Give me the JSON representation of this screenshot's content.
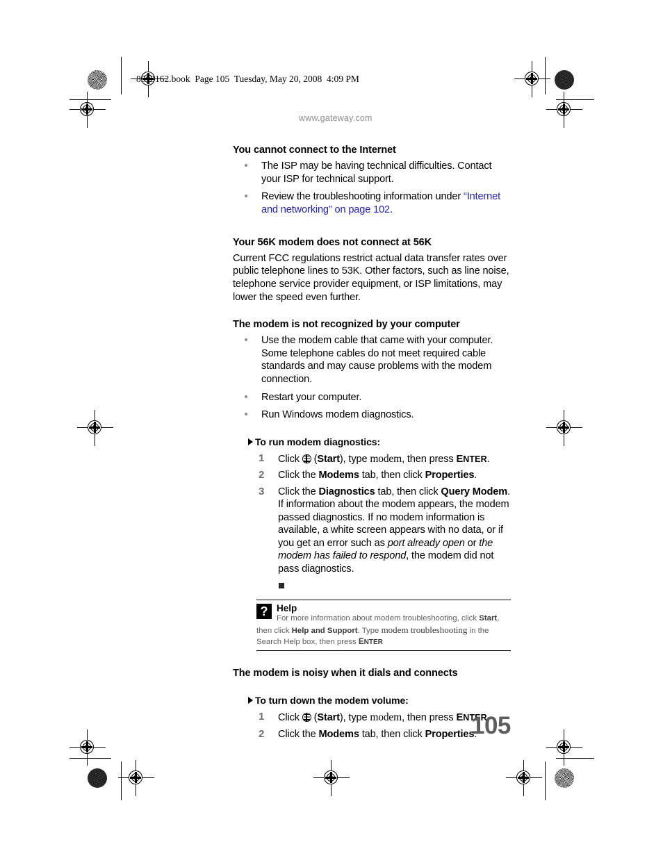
{
  "print_marks": {
    "book_info": "8513162.book  Page 105  Tuesday, May 20, 2008  4:09 PM"
  },
  "running_head": "www.gateway.com",
  "folio": "105",
  "sections": [
    {
      "id": "cannot-connect",
      "heading": "You cannot connect to the Internet",
      "bullets": [
        {
          "parts": [
            {
              "type": "text",
              "value": "The ISP may be having technical difficulties. Contact your ISP for technical support."
            }
          ]
        },
        {
          "parts": [
            {
              "type": "text",
              "value": "Review the troubleshooting information under "
            },
            {
              "type": "link",
              "value": "“Internet and networking” on page 102"
            },
            {
              "type": "text",
              "value": "."
            }
          ]
        }
      ]
    },
    {
      "id": "56k-modem",
      "heading": "Your 56K modem does not connect at 56K",
      "paragraph": "Current FCC regulations restrict actual data transfer rates over public telephone lines to 53K. Other factors, such as line noise, telephone service provider equipment, or ISP limitations, may lower the speed even further."
    },
    {
      "id": "not-recognized",
      "heading": "The modem is not recognized by your computer",
      "bullets": [
        {
          "parts": [
            {
              "type": "text",
              "value": "Use the modem cable that came with your computer. Some telephone cables do not meet required cable standards and may cause problems with the modem connection."
            }
          ]
        },
        {
          "parts": [
            {
              "type": "text",
              "value": "Restart your computer."
            }
          ]
        },
        {
          "parts": [
            {
              "type": "text",
              "value": "Run Windows modem diagnostics."
            }
          ]
        }
      ]
    },
    {
      "id": "noisy-modem",
      "heading": "The modem is noisy when it dials and connects"
    }
  ],
  "procedures": [
    {
      "id": "run-diagnostics",
      "title": "To run modem diagnostics:",
      "steps": [
        {
          "number": "1",
          "parts": [
            {
              "type": "text",
              "value": "Click "
            },
            {
              "type": "icon",
              "value": "start-orb-icon"
            },
            {
              "type": "text",
              "value": " ("
            },
            {
              "type": "bold",
              "value": "Start"
            },
            {
              "type": "text",
              "value": "), type "
            },
            {
              "type": "serif",
              "value": "modem"
            },
            {
              "type": "text",
              "value": ", then press "
            },
            {
              "type": "smallcaps",
              "value": "ENTER"
            },
            {
              "type": "text",
              "value": "."
            }
          ]
        },
        {
          "number": "2",
          "parts": [
            {
              "type": "text",
              "value": "Click the "
            },
            {
              "type": "bold",
              "value": "Modems"
            },
            {
              "type": "text",
              "value": " tab, then click "
            },
            {
              "type": "bold",
              "value": "Properties"
            },
            {
              "type": "text",
              "value": "."
            }
          ]
        },
        {
          "number": "3",
          "parts": [
            {
              "type": "text",
              "value": "Click the "
            },
            {
              "type": "bold",
              "value": "Diagnostics"
            },
            {
              "type": "text",
              "value": " tab, then click "
            },
            {
              "type": "bold",
              "value": "Query Modem"
            },
            {
              "type": "text",
              "value": ". If information about the modem appears, the modem passed diagnostics. If no modem information is available, a white screen appears with no data, or if you get an error such as "
            },
            {
              "type": "italic",
              "value": "port already open"
            },
            {
              "type": "text",
              "value": " or "
            },
            {
              "type": "italic",
              "value": "the modem has failed to respond"
            },
            {
              "type": "text",
              "value": ", the modem did not pass diagnostics."
            }
          ]
        }
      ],
      "end_marker": true
    },
    {
      "id": "turn-down-volume",
      "title": "To turn down the modem volume:",
      "steps": [
        {
          "number": "1",
          "parts": [
            {
              "type": "text",
              "value": "Click "
            },
            {
              "type": "icon",
              "value": "start-orb-icon"
            },
            {
              "type": "text",
              "value": " ("
            },
            {
              "type": "bold",
              "value": "Start"
            },
            {
              "type": "text",
              "value": "), type "
            },
            {
              "type": "serif",
              "value": "modem"
            },
            {
              "type": "text",
              "value": ", then press "
            },
            {
              "type": "smallcaps",
              "value": "ENTER"
            },
            {
              "type": "text",
              "value": "."
            }
          ]
        },
        {
          "number": "2",
          "parts": [
            {
              "type": "text",
              "value": "Click the "
            },
            {
              "type": "bold",
              "value": "Modems"
            },
            {
              "type": "text",
              "value": " tab, then click "
            },
            {
              "type": "bold",
              "value": "Properties"
            },
            {
              "type": "text",
              "value": "."
            }
          ]
        }
      ],
      "end_marker": false
    }
  ],
  "help_note": {
    "icon": "question-mark-icon",
    "icon_glyph": "?",
    "title": "Help",
    "parts": [
      {
        "type": "text",
        "value": "For more information about modem troubleshooting, click "
      },
      {
        "type": "bold",
        "value": "Start"
      },
      {
        "type": "text",
        "value": ", then click "
      },
      {
        "type": "bold",
        "value": "Help and Support"
      },
      {
        "type": "text",
        "value": ". Type "
      },
      {
        "type": "serif",
        "value": "modem troubleshooting"
      },
      {
        "type": "text",
        "value": " in the Search Help box, then press "
      },
      {
        "type": "smallcaps",
        "value": "ENTER"
      }
    ]
  },
  "colors": {
    "link": "#2222cc",
    "folio": "#5d5d5d",
    "running_head": "#8d8d8d",
    "step_number": "#6f6f6f",
    "help_text": "#5f5f5f"
  }
}
